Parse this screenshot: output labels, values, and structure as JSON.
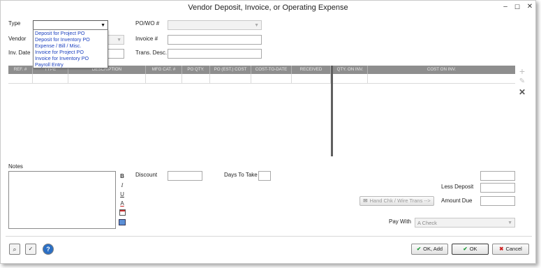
{
  "window": {
    "title": "Vendor Deposit, Invoice, or Operating Expense",
    "minimize": "–",
    "maximize": "☐",
    "close": "✕"
  },
  "form": {
    "type_label": "Type",
    "type_value": "",
    "type_options": [
      "Deposit for Project PO",
      "Deposit for Inventory PO",
      "Expense / Bill / Misc.",
      "Invoice for Project PO",
      "Invoice for Inventory PO",
      "Payroll Entry"
    ],
    "vendor_label": "Vendor",
    "inv_date_label": "Inv. Date",
    "po_wo_label": "PO/WO #",
    "invoice_label": "Invoice #",
    "trans_desc_label": "Trans. Desc."
  },
  "grid": {
    "columns": [
      "REF. #",
      "TYPE",
      "DESCRIPTION",
      "MFG CAT. #",
      "PO QTY.",
      "PO (EST.) COST",
      "COST-TO-DATE",
      "RECEIVED",
      "QTY. ON INV.",
      "COST ON INV."
    ]
  },
  "side_icons": {
    "add": "+",
    "edit": "✎",
    "delete": "✕"
  },
  "notes": {
    "label": "Notes",
    "bold": "B",
    "italic": "I",
    "underline": "U",
    "font_color": "A"
  },
  "totals": {
    "discount_label": "Discount",
    "days_to_take_label": "Days To Take",
    "less_deposit_label": "Less Deposit",
    "amount_due_label": "Amount Due",
    "hand_chk_label": "Hand Chk / Wire Trans -->",
    "pay_with_label": "Pay With",
    "pay_with_value": "A Check"
  },
  "footer": {
    "ok_add": "OK, Add",
    "ok": "OK",
    "cancel": "Cancel"
  },
  "colors": {
    "dropdown_text": "#1a3fbf",
    "grid_header": "#8e8e8e",
    "ok_check": "#1f9a3a",
    "cancel_x": "#cc2222"
  }
}
